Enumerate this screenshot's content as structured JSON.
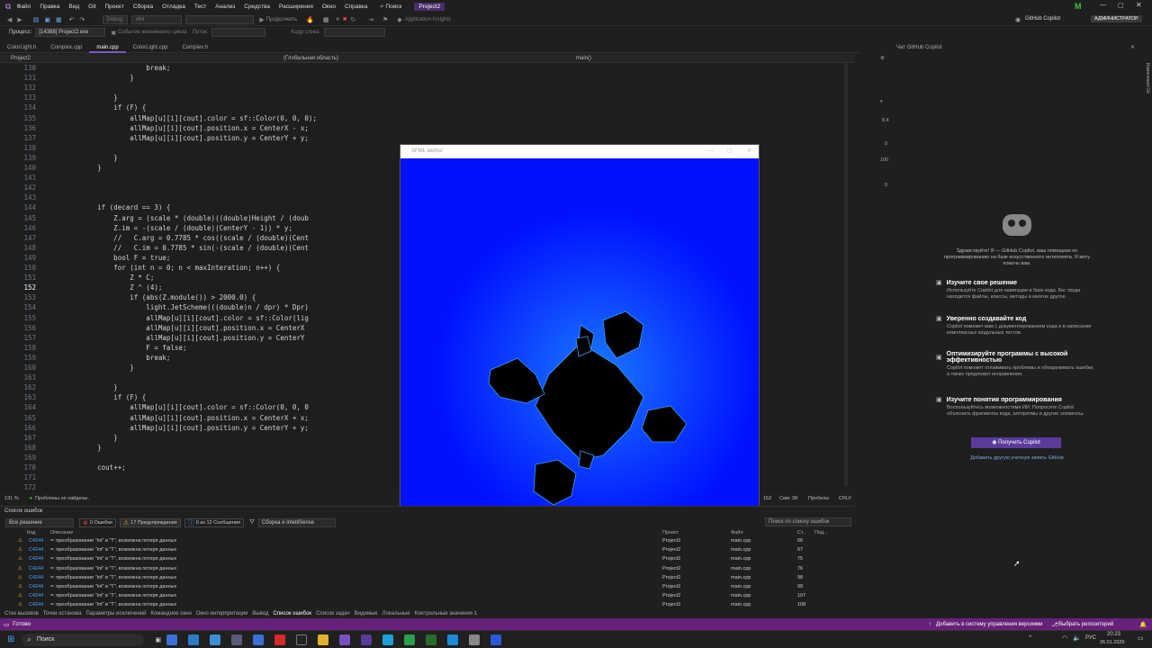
{
  "menubar": {
    "items": [
      "Файл",
      "Правка",
      "Вид",
      "Git",
      "Проект",
      "Сборка",
      "Отладка",
      "Тест",
      "Анализ",
      "Средства",
      "Расширения",
      "Окно",
      "Справка"
    ],
    "search": "Поиск",
    "project_badge": "Project2",
    "profile_letter": "M",
    "copilot_label": "GitHub Copilot",
    "admin_badge": "АДМИНИСТРАТОР"
  },
  "toolbar": {
    "debug_config": "Debug",
    "platform": "x64",
    "continue_label": "Продолжить",
    "app_insights": "Application Insights"
  },
  "processbar": {
    "label": "Процесс:",
    "value": "[14388] Project2.exe",
    "lifecycle": "События жизненного цикла",
    "thread": "Поток:",
    "stack": "Кадр стека:"
  },
  "tabs": [
    "ColorLight.h",
    "Complex.cpp",
    "main.cpp",
    "ColorLight.cpp",
    "Complex.h"
  ],
  "navbar": {
    "project": "Project2",
    "scope": "(Глобальная область)",
    "func": "main()"
  },
  "code_lines": [
    {
      "n": "130",
      "t": "                    break;"
    },
    {
      "n": "131",
      "t": "                }"
    },
    {
      "n": "132",
      "t": ""
    },
    {
      "n": "133",
      "t": "            }"
    },
    {
      "n": "134",
      "t": "            if (F) {"
    },
    {
      "n": "135",
      "t": "                allMap[u][i][cout].color = sf::Color(0, 0, 0);"
    },
    {
      "n": "136",
      "t": "                allMap[u][i][cout].position.x = CenterX - x;"
    },
    {
      "n": "137",
      "t": "                allMap[u][i][cout].position.y = CenterY + y;"
    },
    {
      "n": "138",
      "t": ""
    },
    {
      "n": "139",
      "t": "            }"
    },
    {
      "n": "140",
      "t": "        }"
    },
    {
      "n": "141",
      "t": ""
    },
    {
      "n": "142",
      "t": ""
    },
    {
      "n": "143",
      "t": ""
    },
    {
      "n": "144",
      "t": "        if (decard == 3) {"
    },
    {
      "n": "145",
      "t": "            Z.arg = (scale * (double)((double)Height / (doub"
    },
    {
      "n": "146",
      "t": "            Z.im = -(scale / (double)(CenterY - 1)) * y;"
    },
    {
      "n": "147",
      "t": "            //   C.arg = 0.7785 * cos((scale / (double)(Cent"
    },
    {
      "n": "148",
      "t": "            //   C.im = 0.7785 * sin(-(scale / (double)(Cent"
    },
    {
      "n": "149",
      "t": "            bool F = true;"
    },
    {
      "n": "150",
      "t": "            for (int n = 0; n < maxInteration; n++) {"
    },
    {
      "n": "151",
      "t": "                Z * C;"
    },
    {
      "n": "152",
      "t": "                Z ^ (4);"
    },
    {
      "n": "153",
      "t": "                if (abs(Z.module()) > 2000.0) {"
    },
    {
      "n": "154",
      "t": "                    light.JetScheme(((double)n / dpr) * Dpr)"
    },
    {
      "n": "155",
      "t": "                    allMap[u][i][cout].color = sf::Color(lig"
    },
    {
      "n": "156",
      "t": "                    allMap[u][i][cout].position.x = CenterX"
    },
    {
      "n": "157",
      "t": "                    allMap[u][i][cout].position.y = CenterY"
    },
    {
      "n": "158",
      "t": "                    F = false;"
    },
    {
      "n": "159",
      "t": "                    break;"
    },
    {
      "n": "160",
      "t": "                }"
    },
    {
      "n": "161",
      "t": ""
    },
    {
      "n": "162",
      "t": "            }"
    },
    {
      "n": "163",
      "t": "            if (F) {"
    },
    {
      "n": "164",
      "t": "                allMap[u][i][cout].color = sf::Color(0, 0, 0"
    },
    {
      "n": "165",
      "t": "                allMap[u][i][cout].position.x = CenterX + x;"
    },
    {
      "n": "166",
      "t": "                allMap[u][i][cout].position.y = CenterY + y;"
    },
    {
      "n": "167",
      "t": "            }"
    },
    {
      "n": "168",
      "t": "        }"
    },
    {
      "n": "169",
      "t": ""
    },
    {
      "n": "170",
      "t": "        cout++;"
    },
    {
      "n": "171",
      "t": ""
    },
    {
      "n": "172",
      "t": ""
    }
  ],
  "editor_status": {
    "zoom": "131 %",
    "problems": "Проблемы не найдены.",
    "line": "152",
    "col": "Сим: 38",
    "spaces": "Пробелы",
    "eol": "CRLF"
  },
  "sfml": {
    "title": "SFML works!"
  },
  "copilot": {
    "header": "Чат GitHub Copilot",
    "greeting": "Здравствуйте! Я — GitHub Copilot, ваш помощник по программированию на базе искусственного интеллекта. Я могу помочь вам.",
    "sections": [
      {
        "title": "Изучите свое решение",
        "desc": "Используйте Copilot для навигации в базе кода. Бег труда находится файлы, классы, методы и многое другое."
      },
      {
        "title": "Уверенно создавайте код",
        "desc": "Copilot поможет вам с документированием кода и в написании комплексных модульных тестов."
      },
      {
        "title": "Оптимизируйте программы с высокой эффективностью",
        "desc": "Copilot поможет отлаживать проблемы и обнаруживать ошибки, а также предложит исправления."
      },
      {
        "title": "Изучите понятия программирования",
        "desc": "Воспользуйтесь возможностями ИИ. Попросите Copilot объяснить фрагменты кода, алгоритмы и другие элементы."
      }
    ],
    "button": "Получить Copilot",
    "link": "Добавить другую учетную запись GitHub"
  },
  "errors": {
    "title": "Список ошибок",
    "scope": "Все решение",
    "errors_count": "0 Ошибки",
    "warnings_count": "17 Предупреждения",
    "messages_count": "0 из 12 Сообщения",
    "build": "Сборка и IntelliSense",
    "search": "Поиск по списку ошибок",
    "columns": [
      "Код",
      "Описание",
      "Проект",
      "Файл",
      "Ст...",
      "Под..."
    ],
    "rows": [
      {
        "code": "C4244",
        "desc": "=: преобразование \"int\" в \"T\", возможна потеря данных",
        "project": "Project2",
        "file": "main.cpp",
        "line": "66"
      },
      {
        "code": "C4244",
        "desc": "=: преобразование \"int\" в \"T\", возможна потеря данных",
        "project": "Project2",
        "file": "main.cpp",
        "line": "67"
      },
      {
        "code": "C4244",
        "desc": "=: преобразование \"int\" в \"T\", возможна потеря данных",
        "project": "Project2",
        "file": "main.cpp",
        "line": "75"
      },
      {
        "code": "C4244",
        "desc": "=: преобразование \"int\" в \"T\", возможна потеря данных",
        "project": "Project2",
        "file": "main.cpp",
        "line": "76"
      },
      {
        "code": "C4244",
        "desc": "=: преобразование \"int\" в \"T\", возможна потеря данных",
        "project": "Project2",
        "file": "main.cpp",
        "line": "98"
      },
      {
        "code": "C4244",
        "desc": "=: преобразование \"int\" в \"T\", возможна потеря данных",
        "project": "Project2",
        "file": "main.cpp",
        "line": "99"
      },
      {
        "code": "C4244",
        "desc": "=: преобразование \"int\" в \"T\", возможна потеря данных",
        "project": "Project2",
        "file": "main.cpp",
        "line": "107"
      },
      {
        "code": "C4244",
        "desc": "=: преобразование \"int\" в \"T\", возможна потеря данных",
        "project": "Project2",
        "file": "main.cpp",
        "line": "108"
      }
    ]
  },
  "bottom_tabs": [
    "Стек вызовов",
    "Точки останова",
    "Параметры исключений",
    "Командное окно",
    "Окно интерпретации",
    "Вывод",
    "Список ошибок",
    "Список задач",
    "Видимые",
    "Локальные",
    "Контрольные значения 1"
  ],
  "statusbar": {
    "ready": "Готово",
    "add_vcs": "Добавить в систему управления версиями",
    "repo": "Выбрать репозиторий"
  },
  "taskbar": {
    "search": "Поиск",
    "lang": "РУС",
    "time": "20:23",
    "date": "26.01.2026"
  },
  "colors": {
    "accent": "#68217a",
    "sfml_bg": "#0011ff"
  }
}
